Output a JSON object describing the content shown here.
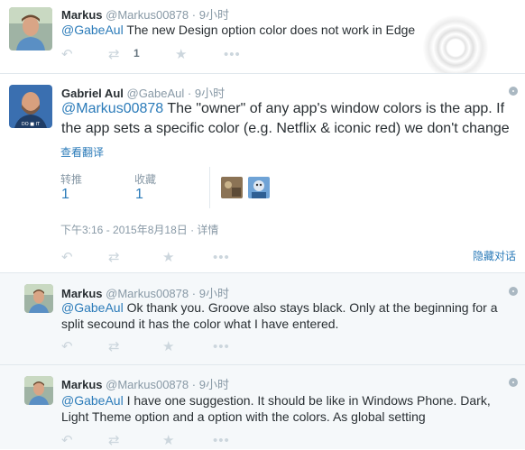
{
  "tweets": [
    {
      "name": "Markus",
      "handle": "@Markus00878",
      "dot": "·",
      "time": "9小时",
      "mention": "@GabeAul",
      "text": " The new Design option color does not work in Edge",
      "retweet_count": "1",
      "avatar_caption": ""
    },
    {
      "name": "Gabriel Aul",
      "handle": "@GabeAul",
      "dot": "·",
      "time": "9小时",
      "mention": "@Markus00878",
      "text": " The \"owner\" of any app's window colors is the app. If the app sets a specific color (e.g. Netflix & iconic red) we don't change",
      "translate": "查看翻译",
      "retweets_label": "转推",
      "retweets_value": "1",
      "favorites_label": "收藏",
      "favorites_value": "1",
      "detail_time": "下午3:16 - 2015年8月18日 · 详情",
      "hide_conversation": "隐藏对话",
      "avatar_caption": "DO ■ IT"
    },
    {
      "name": "Markus",
      "handle": "@Markus00878",
      "dot": "·",
      "time": "9小时",
      "mention": "@GabeAul",
      "text": " Ok thank you. Groove also stays black. Only at the beginning for a split secound it has the color what I have entered."
    },
    {
      "name": "Markus",
      "handle": "@Markus00878",
      "dot": "·",
      "time": "9小时",
      "mention": "@GabeAul",
      "text": " I have one suggestion. It should be like in Windows Phone. Dark, Light Theme option and a option with the colors. As global setting"
    }
  ],
  "icons": {
    "reply": "reply-icon",
    "retweet": "retweet-icon",
    "favorite": "star-icon",
    "more": "more-icon"
  },
  "colors": {
    "link": "#2b7bb9",
    "muted": "#8899a6",
    "reply_bg": "#f5f8fa",
    "action_icon": "#ccd6dd"
  }
}
